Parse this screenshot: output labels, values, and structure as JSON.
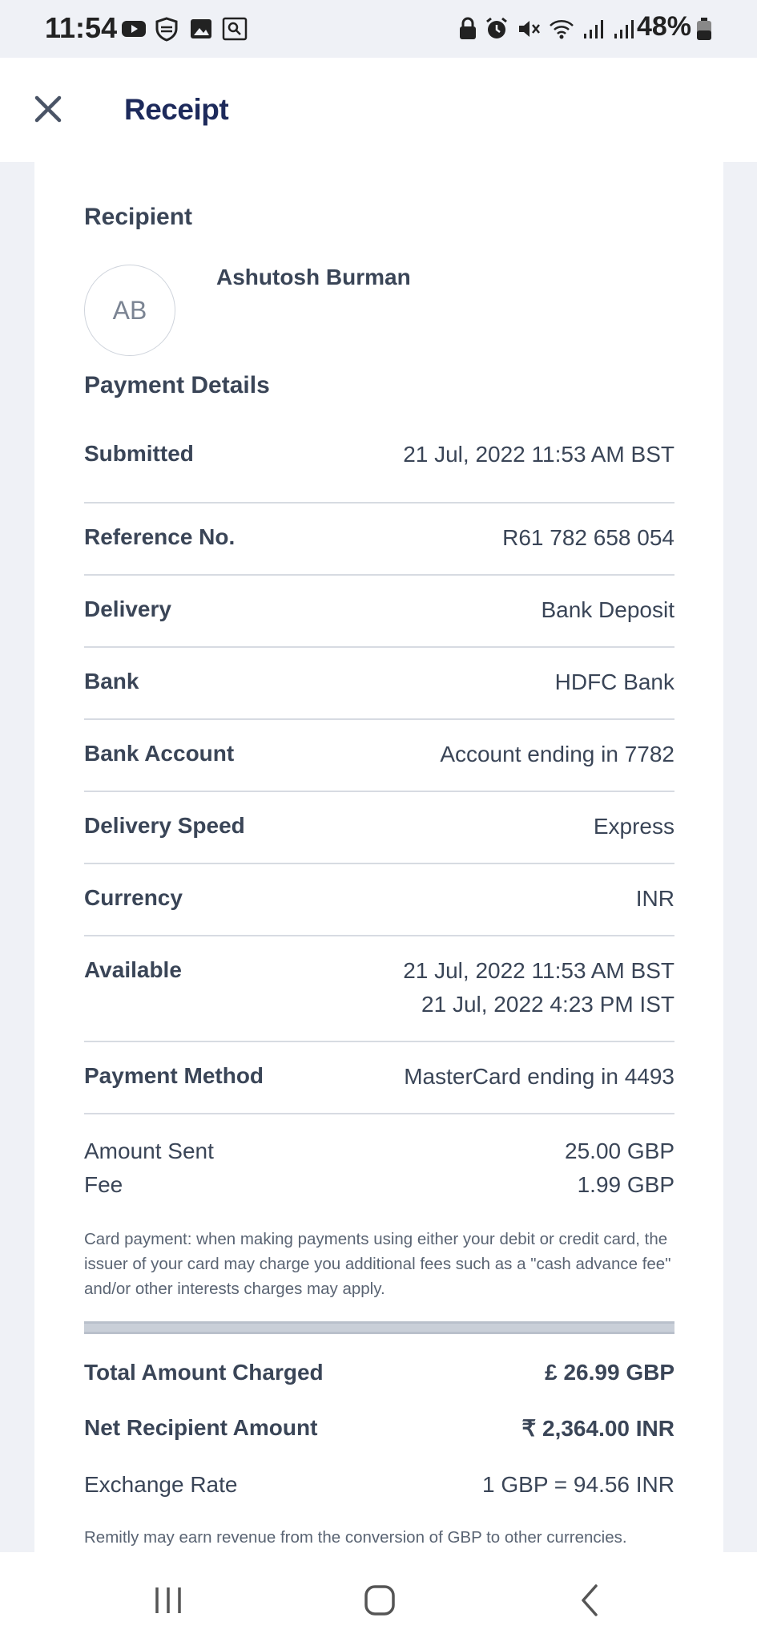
{
  "status_bar": {
    "time": "11:54",
    "battery": "48%",
    "icons_left": [
      "youtube-icon",
      "shield-icon",
      "gallery-icon",
      "search-app-icon"
    ],
    "icons_right": [
      "lock-icon",
      "alarm-icon",
      "mute-icon",
      "wifi-icon",
      "signal-icon",
      "signal-icon",
      "battery-icon"
    ]
  },
  "header": {
    "title": "Receipt"
  },
  "recipient": {
    "section_title": "Recipient",
    "initials": "AB",
    "name": "Ashutosh Burman"
  },
  "payment_details": {
    "section_title": "Payment Details",
    "rows": [
      {
        "label": "Submitted",
        "value": "21 Jul, 2022 11:53 AM BST"
      },
      {
        "label": "Reference No.",
        "value": "R61 782 658 054"
      },
      {
        "label": "Delivery",
        "value": "Bank Deposit"
      },
      {
        "label": "Bank",
        "value": "HDFC Bank"
      },
      {
        "label": "Bank Account",
        "value": "Account ending in 7782"
      },
      {
        "label": "Delivery Speed",
        "value": "Express"
      },
      {
        "label": "Currency",
        "value": "INR"
      },
      {
        "label": "Available",
        "value": "21 Jul, 2022 11:53 AM BST",
        "value2": "21 Jul, 2022 4:23 PM IST"
      },
      {
        "label": "Payment Method",
        "value": "MasterCard ending in 4493"
      }
    ]
  },
  "amounts": {
    "amount_sent_label": "Amount Sent",
    "amount_sent_value": "25.00 GBP",
    "fee_label": "Fee",
    "fee_value": "1.99 GBP",
    "card_note": "Card payment: when making payments using either your debit or credit card, the issuer of your card may charge you additional fees such as a \"cash advance fee\" and/or other interests charges may apply."
  },
  "totals": {
    "total_label": "Total Amount Charged",
    "total_value": "£ 26.99 GBP",
    "net_label": "Net Recipient Amount",
    "net_value": "₹ 2,364.00 INR",
    "rate_label": "Exchange Rate",
    "rate_value": "1 GBP = 94.56 INR",
    "revenue_note": "Remitly may earn revenue from the conversion of GBP to other currencies."
  },
  "navbar": {
    "buttons": [
      "recent-apps-icon",
      "home-icon",
      "back-icon"
    ]
  },
  "colors": {
    "title": "#1d2a5b",
    "text": "#3a4557",
    "background": "#eff1f6",
    "divider": "#d7dbe2"
  }
}
